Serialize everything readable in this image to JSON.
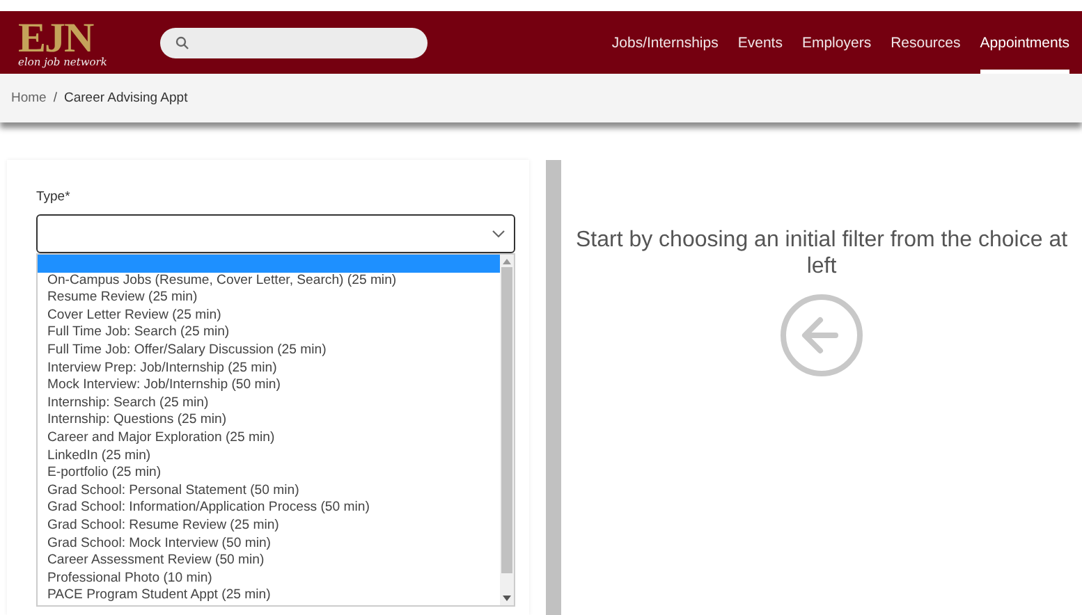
{
  "header": {
    "logo": {
      "mark": "EJN",
      "tagline": "elon job network"
    },
    "nav": [
      {
        "label": "Jobs/Internships",
        "selected": false
      },
      {
        "label": "Events",
        "selected": false
      },
      {
        "label": "Employers",
        "selected": false
      },
      {
        "label": "Resources",
        "selected": false
      },
      {
        "label": "Appointments",
        "selected": true
      }
    ]
  },
  "breadcrumb": {
    "separator": "/",
    "items": [
      "Home",
      "Career Advising Appt"
    ]
  },
  "form": {
    "type_label": "Type*",
    "dropdown": {
      "expanded": true,
      "blank_option_selected": true,
      "options": [
        {
          "label": "On-Campus Jobs (Resume, Cover Letter, Search) (25 min)",
          "selected": false
        },
        {
          "label": "Resume Review (25 min)",
          "selected": false
        },
        {
          "label": "Cover Letter Review (25 min)",
          "selected": false
        },
        {
          "label": "Full Time Job: Search (25 min)",
          "selected": false
        },
        {
          "label": "Full Time Job: Offer/Salary Discussion (25 min)",
          "selected": false
        },
        {
          "label": "Interview Prep: Job/Internship (25 min)",
          "selected": false
        },
        {
          "label": "Mock Interview: Job/Internship (50 min)",
          "selected": false
        },
        {
          "label": "Internship: Search (25 min)",
          "selected": false
        },
        {
          "label": "Internship: Questions (25 min)",
          "selected": false
        },
        {
          "label": "Career and Major Exploration (25 min)",
          "selected": false
        },
        {
          "label": "LinkedIn (25 min)",
          "selected": false
        },
        {
          "label": "E-portfolio (25 min)",
          "selected": false
        },
        {
          "label": "Grad School: Personal Statement (50 min)",
          "selected": false
        },
        {
          "label": "Grad School: Information/Application Process (50 min)",
          "selected": false
        },
        {
          "label": "Grad School: Resume Review (25 min)",
          "selected": false
        },
        {
          "label": "Grad School: Mock Interview (50 min)",
          "selected": false
        },
        {
          "label": "Career Assessment Review (50 min)",
          "selected": false
        },
        {
          "label": "Professional Photo (10 min)",
          "selected": false
        },
        {
          "label": "PACE Program Student Appt (25 min)",
          "selected": false
        }
      ]
    }
  },
  "message": "Start by choosing an initial filter from the choice at left"
}
